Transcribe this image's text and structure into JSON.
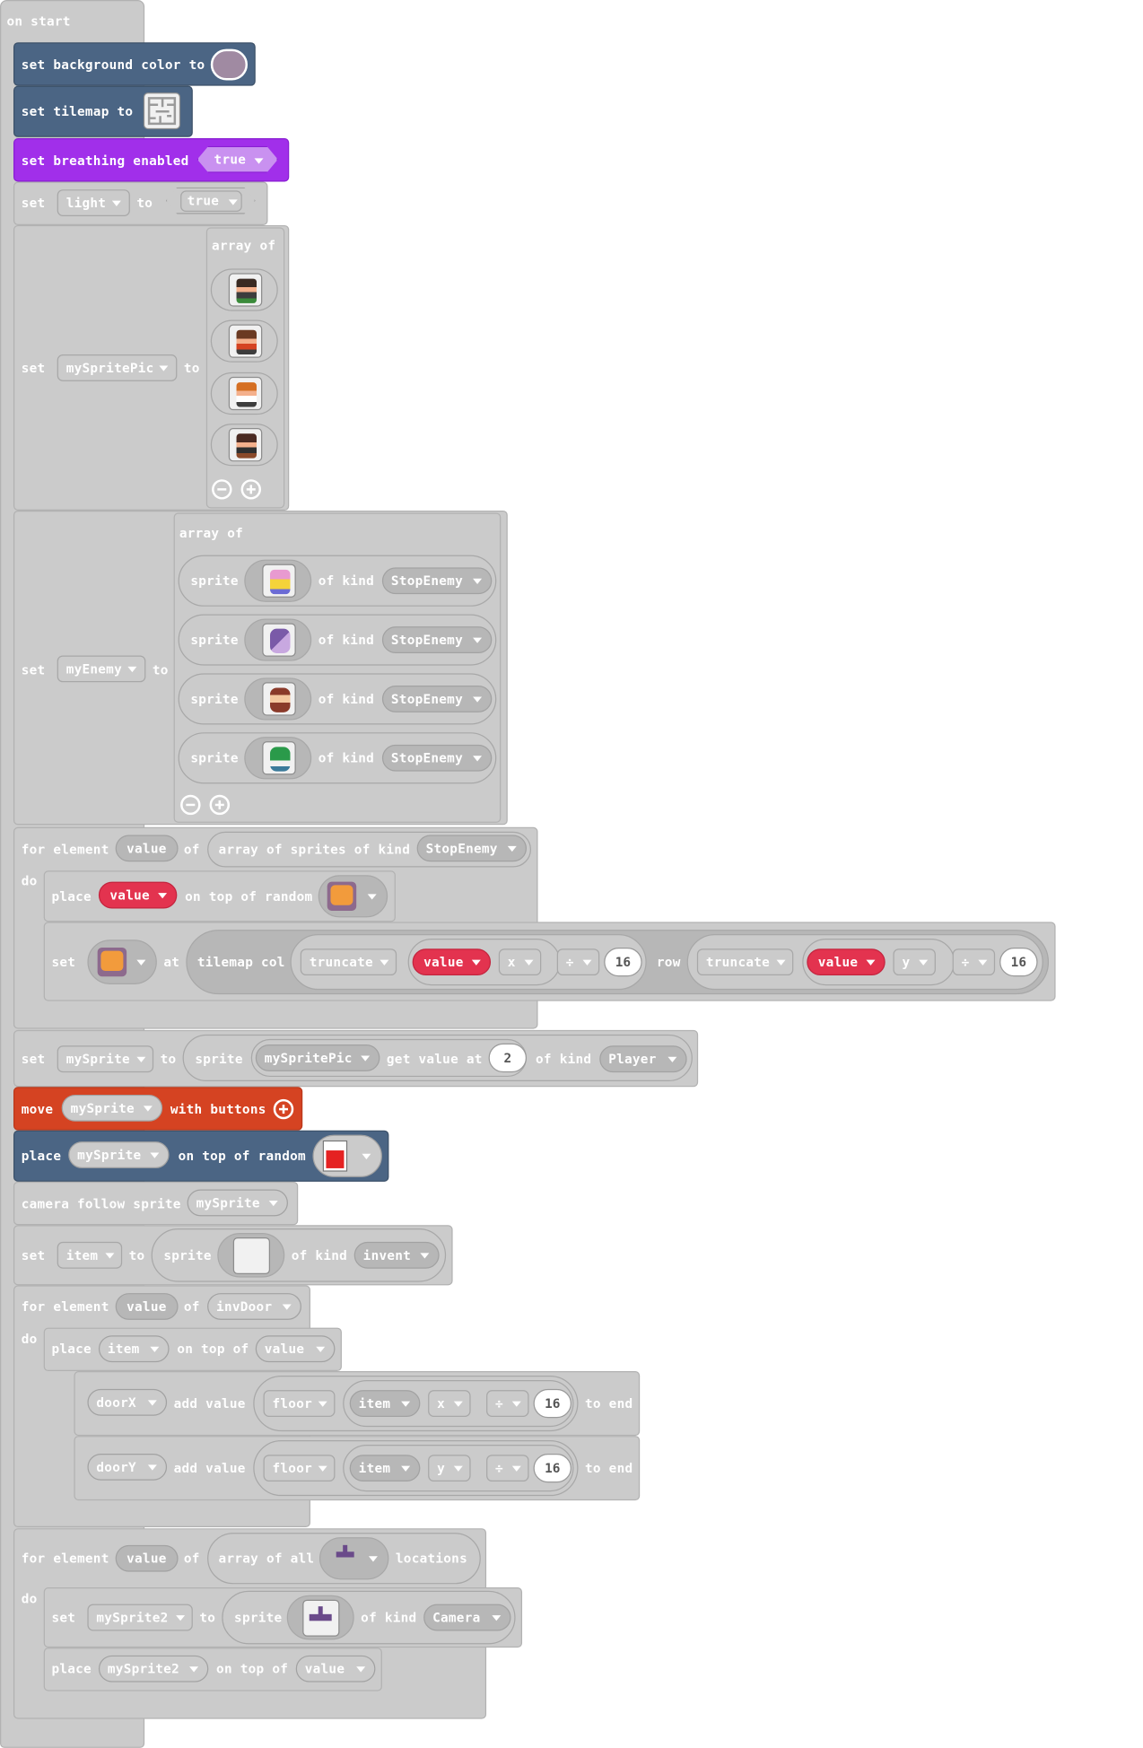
{
  "on_start": {
    "label": "on start"
  },
  "bg": {
    "label": "set background color to",
    "color": "#a08aa2"
  },
  "tilemap": {
    "label": "set tilemap to"
  },
  "breathing": {
    "label": "set breathing enabled",
    "value": "true"
  },
  "light": {
    "set": "set",
    "var": "light",
    "to": "to",
    "value": "true"
  },
  "spritepic": {
    "set": "set",
    "var": "mySpritePic",
    "to": "to",
    "array_label": "array of"
  },
  "enemy": {
    "set": "set",
    "var": "myEnemy",
    "to": "to",
    "array_label": "array of",
    "sprite": "sprite",
    "of_kind": "of kind",
    "kind": "StopEnemy"
  },
  "loop1": {
    "for_element": "for element",
    "value": "value",
    "of": "of",
    "array_sprites": "array of sprites of kind",
    "kind": "StopEnemy",
    "do": "do",
    "place": "place",
    "place_value": "value",
    "on_top_random": "on top of random",
    "set": "set",
    "at": "at",
    "tilemap_col": "tilemap col",
    "truncate": "truncate",
    "x": "x",
    "div": "÷",
    "sixteen": "16",
    "row": "row",
    "y": "y"
  },
  "mysprite": {
    "set": "set",
    "var": "mySprite",
    "to": "to",
    "sprite": "sprite",
    "arr": "mySpritePic",
    "get_value_at": "get value at",
    "index": "2",
    "of_kind": "of kind",
    "kind": "Player"
  },
  "move": {
    "label": "move",
    "var": "mySprite",
    "with_buttons": "with buttons"
  },
  "place2": {
    "label": "place",
    "var": "mySprite",
    "on_top_random": "on top of random"
  },
  "camera": {
    "label": "camera follow sprite",
    "var": "mySprite"
  },
  "item": {
    "set": "set",
    "var": "item",
    "to": "to",
    "sprite": "sprite",
    "of_kind": "of kind",
    "kind": "invent"
  },
  "loop2": {
    "for_element": "for element",
    "value": "value",
    "of": "of",
    "list": "invDoor",
    "do": "do",
    "place": "place",
    "item": "item",
    "on_top_of": "on top of",
    "place_value": "value",
    "doorX": "doorX",
    "doorY": "doorY",
    "add_value": "add value",
    "floor": "floor",
    "x": "x",
    "y": "y",
    "div": "÷",
    "sixteen": "16",
    "to_end": "to end"
  },
  "loop3": {
    "for_element": "for element",
    "value": "value",
    "of": "of",
    "array_all": "array of all",
    "locations": "locations",
    "do": "do",
    "set": "set",
    "var": "mySprite2",
    "to": "to",
    "sprite": "sprite",
    "of_kind": "of kind",
    "kind": "Camera",
    "place": "place",
    "on_top_of": "on top of",
    "place_value": "value"
  }
}
